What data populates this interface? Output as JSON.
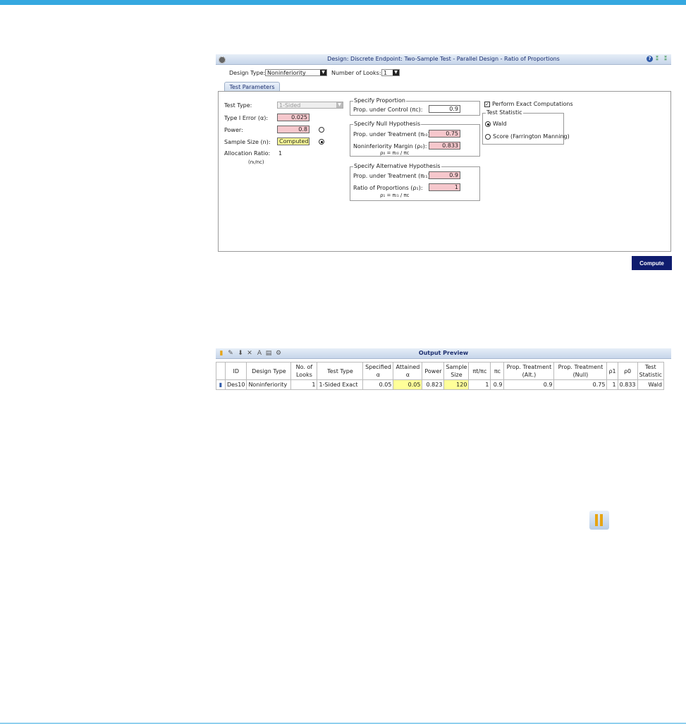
{
  "design": {
    "title": "Design: Discrete Endpoint: Two-Sample Test - Parallel Design - Ratio of Proportions",
    "design_type_label": "Design Type:",
    "design_type_value": "Noninferiority",
    "looks_label": "Number of Looks:",
    "looks_value": "1",
    "tab_label": "Test Parameters",
    "test_type_label": "Test Type:",
    "test_type_value": "1-Sided",
    "alpha_label": "Type I Error (α):",
    "alpha_value": "0.025",
    "power_label": "Power:",
    "power_value": "0.8",
    "sample_size_label": "Sample Size (n):",
    "sample_size_value": "Computed",
    "allocation_label": "Allocation Ratio:",
    "allocation_value": "1",
    "allocation_sub": "(nₜ/nᴄ)",
    "specify_proportion_legend": "Specify Proportion",
    "prop_control_label": "Prop. under Control (πᴄ):",
    "prop_control_value": "0.9",
    "null_legend": "Specify Null Hypothesis",
    "null_prop_treat_label": "Prop. under Treatment (πₜ₀):",
    "null_prop_treat_value": "0.75",
    "margin_label": "Noninferiority Margin (ρ₀):",
    "margin_value": "0.833",
    "margin_formula": "ρ₀ = πₜ₀ / πᴄ",
    "alt_legend": "Specify Alternative Hypothesis",
    "alt_prop_treat_label": "Prop. under Treatment (πₜ₁):",
    "alt_prop_treat_value": "0.9",
    "ratio_label": "Ratio of Proportions (ρ₁):",
    "ratio_value": "1",
    "ratio_formula": "ρ₁ = πₜ₁ / πᴄ",
    "exact_label": "Perform Exact Computations",
    "test_stat_legend": "Test Statistic",
    "wald_label": "Wald",
    "score_label": "Score (Farrington Manning)",
    "compute_label": "Compute"
  },
  "output": {
    "title": "Output Preview",
    "columns": [
      "ID",
      "Design Type",
      "No. of Looks",
      "Test Type",
      "Specified α",
      "Attained α",
      "Power",
      "Sample Size",
      "πt/πc",
      "πc",
      "Prop. Treatment (Alt.)",
      "Prop. Treatment (Null)",
      "ρ1",
      "ρ0",
      "Test Statistic"
    ],
    "row": [
      "Des10",
      "Noninferiority",
      "1",
      "1-Sided Exact",
      "0.05",
      "0.05",
      "0.823",
      "120",
      "1",
      "0.9",
      "0.9",
      "0.75",
      "1",
      "0.833",
      "Wald"
    ]
  }
}
